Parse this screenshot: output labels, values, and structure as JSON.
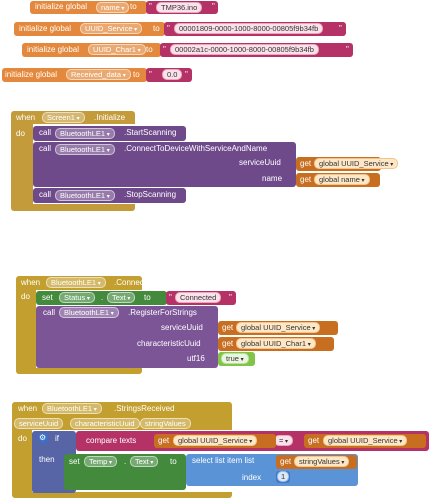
{
  "globals": [
    {
      "prefix": "initialize global",
      "name": "name",
      "to": "to",
      "value": "TMP36.ino"
    },
    {
      "prefix": "initialize global",
      "name": "UUID_Service",
      "to": "to",
      "value": "00001809-0000-1000-8000-00805f9b34fb"
    },
    {
      "prefix": "initialize global",
      "name": "UUID_Char1",
      "to": "to",
      "value": "00002a1c-0000-1000-8000-00805f9b34fb"
    },
    {
      "prefix": "initialize global",
      "name": "Received_data",
      "to": "to",
      "value": "0.0"
    }
  ],
  "init_event": {
    "when": "when",
    "component": "Screen1",
    "event": ".Initialize",
    "do": "do",
    "calls": [
      {
        "call": "call",
        "component": "BluetoothLE1",
        "method": ".StartScanning"
      },
      {
        "call": "call",
        "component": "BluetoothLE1",
        "method": ".ConnectToDeviceWithServiceAndName",
        "args": [
          {
            "label": "serviceUuid",
            "get": "get",
            "var": "global UUID_Service"
          },
          {
            "label": "name",
            "get": "get",
            "var": "global name"
          }
        ]
      },
      {
        "call": "call",
        "component": "BluetoothLE1",
        "method": ".StopScanning"
      }
    ]
  },
  "connected_event": {
    "when": "when",
    "component": "BluetoothLE1",
    "event": ".Connected",
    "do": "do",
    "set": {
      "set": "set",
      "component": "Status",
      "dot": ".",
      "prop": "Text",
      "to": "to",
      "value": "Connected"
    },
    "call": {
      "call": "call",
      "component": "BluetoothLE1",
      "method": ".RegisterForStrings",
      "args": [
        {
          "label": "serviceUuid",
          "get": "get",
          "var": "global UUID_Service"
        },
        {
          "label": "characteristicUuid",
          "get": "get",
          "var": "global UUID_Char1"
        },
        {
          "label": "utf16",
          "value": "true"
        }
      ]
    }
  },
  "strings_event": {
    "when": "when",
    "component": "BluetoothLE1",
    "event": ".StringsReceived",
    "params": [
      "serviceUuid",
      "characteristicUuid",
      "stringValues"
    ],
    "do": "do",
    "if": "if",
    "then": "then",
    "compare": {
      "label": "compare texts",
      "get": "get",
      "left": "global UUID_Service",
      "op": "=",
      "right": "global UUID_Service"
    },
    "set": {
      "set": "set",
      "component": "Temp",
      "dot": ".",
      "prop": "Text",
      "to": "to"
    },
    "select": {
      "label": "select list item  list",
      "get": "get",
      "var": "stringValues",
      "index_label": "index",
      "index": "1"
    }
  }
}
